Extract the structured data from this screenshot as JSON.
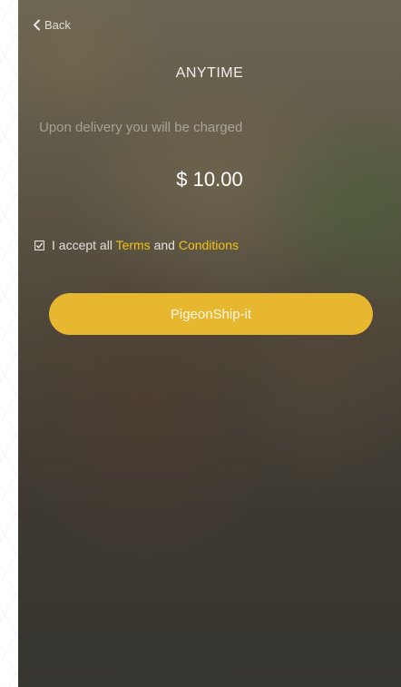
{
  "nav": {
    "back_label": "Back"
  },
  "delivery": {
    "title": "ANYTIME",
    "subtitle": "Upon delivery you will be charged",
    "amount": "$ 10.00"
  },
  "terms": {
    "checked": true,
    "prefix": "I accept all ",
    "terms_link": "Terms",
    "middle": " and ",
    "conditions_link": "Conditions"
  },
  "action": {
    "submit_label": "PigeonShip-it"
  },
  "colors": {
    "accent": "#e6b72f",
    "link": "#f0c419"
  }
}
